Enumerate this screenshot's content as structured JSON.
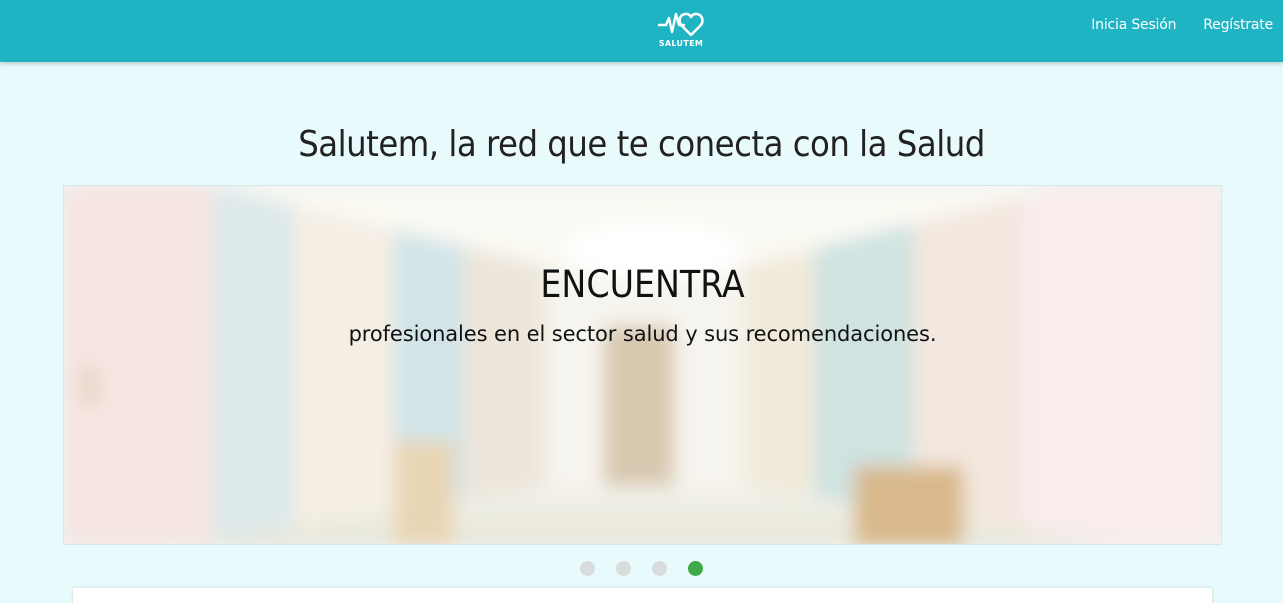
{
  "header": {
    "logo_text": "SALUTEM",
    "nav": [
      {
        "label": "Inicia Sesión"
      },
      {
        "label": "Regístrate"
      }
    ],
    "background_color": "#1fb4c3"
  },
  "hero": {
    "title": "Salutem, la red que te conecta con la Salud"
  },
  "carousel": {
    "slide": {
      "heading": "ENCUENTRA",
      "text": "profesionales en el sector salud y sus recomendaciones."
    },
    "indicators": {
      "count": 4,
      "active_index": 3,
      "active_color": "#3eaa4a",
      "inactive_color": "#d9dcdc"
    }
  }
}
